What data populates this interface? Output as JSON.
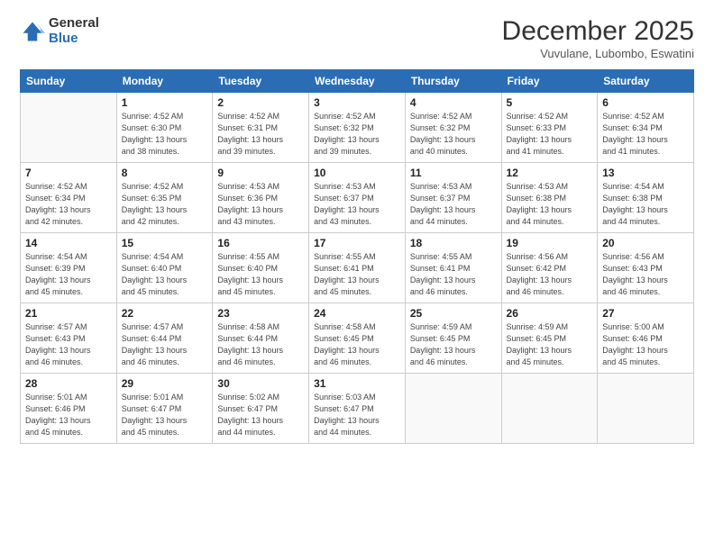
{
  "logo": {
    "general": "General",
    "blue": "Blue"
  },
  "header": {
    "month": "December 2025",
    "location": "Vuvulane, Lubombo, Eswatini"
  },
  "weekdays": [
    "Sunday",
    "Monday",
    "Tuesday",
    "Wednesday",
    "Thursday",
    "Friday",
    "Saturday"
  ],
  "weeks": [
    [
      {
        "day": "",
        "info": ""
      },
      {
        "day": "1",
        "info": "Sunrise: 4:52 AM\nSunset: 6:30 PM\nDaylight: 13 hours\nand 38 minutes."
      },
      {
        "day": "2",
        "info": "Sunrise: 4:52 AM\nSunset: 6:31 PM\nDaylight: 13 hours\nand 39 minutes."
      },
      {
        "day": "3",
        "info": "Sunrise: 4:52 AM\nSunset: 6:32 PM\nDaylight: 13 hours\nand 39 minutes."
      },
      {
        "day": "4",
        "info": "Sunrise: 4:52 AM\nSunset: 6:32 PM\nDaylight: 13 hours\nand 40 minutes."
      },
      {
        "day": "5",
        "info": "Sunrise: 4:52 AM\nSunset: 6:33 PM\nDaylight: 13 hours\nand 41 minutes."
      },
      {
        "day": "6",
        "info": "Sunrise: 4:52 AM\nSunset: 6:34 PM\nDaylight: 13 hours\nand 41 minutes."
      }
    ],
    [
      {
        "day": "7",
        "info": "Sunrise: 4:52 AM\nSunset: 6:34 PM\nDaylight: 13 hours\nand 42 minutes."
      },
      {
        "day": "8",
        "info": "Sunrise: 4:52 AM\nSunset: 6:35 PM\nDaylight: 13 hours\nand 42 minutes."
      },
      {
        "day": "9",
        "info": "Sunrise: 4:53 AM\nSunset: 6:36 PM\nDaylight: 13 hours\nand 43 minutes."
      },
      {
        "day": "10",
        "info": "Sunrise: 4:53 AM\nSunset: 6:37 PM\nDaylight: 13 hours\nand 43 minutes."
      },
      {
        "day": "11",
        "info": "Sunrise: 4:53 AM\nSunset: 6:37 PM\nDaylight: 13 hours\nand 44 minutes."
      },
      {
        "day": "12",
        "info": "Sunrise: 4:53 AM\nSunset: 6:38 PM\nDaylight: 13 hours\nand 44 minutes."
      },
      {
        "day": "13",
        "info": "Sunrise: 4:54 AM\nSunset: 6:38 PM\nDaylight: 13 hours\nand 44 minutes."
      }
    ],
    [
      {
        "day": "14",
        "info": "Sunrise: 4:54 AM\nSunset: 6:39 PM\nDaylight: 13 hours\nand 45 minutes."
      },
      {
        "day": "15",
        "info": "Sunrise: 4:54 AM\nSunset: 6:40 PM\nDaylight: 13 hours\nand 45 minutes."
      },
      {
        "day": "16",
        "info": "Sunrise: 4:55 AM\nSunset: 6:40 PM\nDaylight: 13 hours\nand 45 minutes."
      },
      {
        "day": "17",
        "info": "Sunrise: 4:55 AM\nSunset: 6:41 PM\nDaylight: 13 hours\nand 45 minutes."
      },
      {
        "day": "18",
        "info": "Sunrise: 4:55 AM\nSunset: 6:41 PM\nDaylight: 13 hours\nand 46 minutes."
      },
      {
        "day": "19",
        "info": "Sunrise: 4:56 AM\nSunset: 6:42 PM\nDaylight: 13 hours\nand 46 minutes."
      },
      {
        "day": "20",
        "info": "Sunrise: 4:56 AM\nSunset: 6:43 PM\nDaylight: 13 hours\nand 46 minutes."
      }
    ],
    [
      {
        "day": "21",
        "info": "Sunrise: 4:57 AM\nSunset: 6:43 PM\nDaylight: 13 hours\nand 46 minutes."
      },
      {
        "day": "22",
        "info": "Sunrise: 4:57 AM\nSunset: 6:44 PM\nDaylight: 13 hours\nand 46 minutes."
      },
      {
        "day": "23",
        "info": "Sunrise: 4:58 AM\nSunset: 6:44 PM\nDaylight: 13 hours\nand 46 minutes."
      },
      {
        "day": "24",
        "info": "Sunrise: 4:58 AM\nSunset: 6:45 PM\nDaylight: 13 hours\nand 46 minutes."
      },
      {
        "day": "25",
        "info": "Sunrise: 4:59 AM\nSunset: 6:45 PM\nDaylight: 13 hours\nand 46 minutes."
      },
      {
        "day": "26",
        "info": "Sunrise: 4:59 AM\nSunset: 6:45 PM\nDaylight: 13 hours\nand 45 minutes."
      },
      {
        "day": "27",
        "info": "Sunrise: 5:00 AM\nSunset: 6:46 PM\nDaylight: 13 hours\nand 45 minutes."
      }
    ],
    [
      {
        "day": "28",
        "info": "Sunrise: 5:01 AM\nSunset: 6:46 PM\nDaylight: 13 hours\nand 45 minutes."
      },
      {
        "day": "29",
        "info": "Sunrise: 5:01 AM\nSunset: 6:47 PM\nDaylight: 13 hours\nand 45 minutes."
      },
      {
        "day": "30",
        "info": "Sunrise: 5:02 AM\nSunset: 6:47 PM\nDaylight: 13 hours\nand 44 minutes."
      },
      {
        "day": "31",
        "info": "Sunrise: 5:03 AM\nSunset: 6:47 PM\nDaylight: 13 hours\nand 44 minutes."
      },
      {
        "day": "",
        "info": ""
      },
      {
        "day": "",
        "info": ""
      },
      {
        "day": "",
        "info": ""
      }
    ]
  ]
}
